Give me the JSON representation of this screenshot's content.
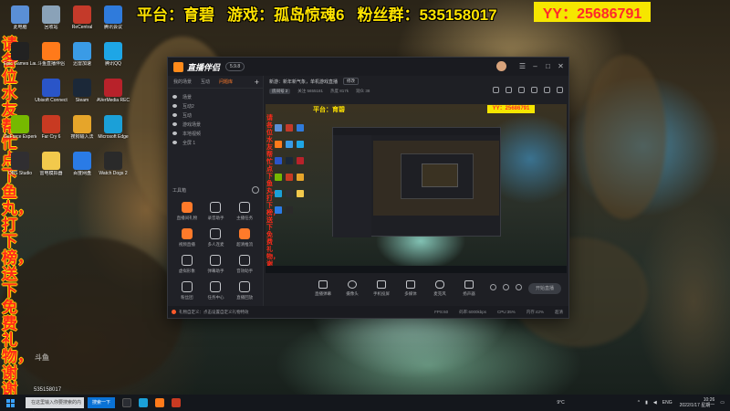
{
  "overlay": {
    "platform": "平台：育碧",
    "game": "游戏：孤岛惊魂6",
    "fans": "粉丝群：535158017",
    "qq": "YY：25686791",
    "side_text": "请各位水友帮忙点下鱼丸，打下榜，送下免费礼物，谢谢"
  },
  "desktop": {
    "icons": [
      {
        "label": "此电脑",
        "icon": "computer-icon",
        "color": "#5a8fd6"
      },
      {
        "label": "回收站",
        "icon": "recycle-bin-icon",
        "color": "#8aa2b8"
      },
      {
        "label": "ReCentral",
        "icon": "recentral-icon",
        "color": "#c43a2a"
      },
      {
        "label": "腾讯会议",
        "icon": "meeting-icon",
        "color": "#2f7bdc"
      },
      {
        "label": "Epic Games Launcher",
        "icon": "epic-icon",
        "color": "#222222"
      },
      {
        "label": "斗鱼直播伴侣",
        "icon": "douyu-icon",
        "color": "#ff7a1a"
      },
      {
        "label": "迅雷加速",
        "icon": "xunlei-icon",
        "color": "#3a9be6"
      },
      {
        "label": "腾讯QQ",
        "icon": "qq-icon",
        "color": "#1ea6e6"
      },
      {
        "label": "Ubisoft Connect",
        "icon": "ubisoft-icon",
        "color": "#2a55c8"
      },
      {
        "label": "Steam",
        "icon": "steam-icon",
        "color": "#1b2838"
      },
      {
        "label": "AVerMedia RECentral",
        "icon": "avermedia-icon",
        "color": "#b8222a"
      },
      {
        "label": "GeForce Experience",
        "icon": "nvidia-icon",
        "color": "#76b900"
      },
      {
        "label": "Far Cry 6",
        "icon": "farcry-icon",
        "color": "#c83a22"
      },
      {
        "label": "搜狗输入法",
        "icon": "sogou-icon",
        "color": "#e6a52a"
      },
      {
        "label": "Microsoft Edge",
        "icon": "edge-icon",
        "color": "#1ba0d8"
      },
      {
        "label": "OBS Studio",
        "icon": "obs-icon",
        "color": "#302e31"
      },
      {
        "label": "雷电模拟器",
        "icon": "emulator-icon",
        "color": "#f2c94c"
      },
      {
        "label": "百度网盘",
        "icon": "baidu-icon",
        "color": "#2a7be6"
      },
      {
        "label": "Watch Dogs 2",
        "icon": "watchdogs-icon",
        "color": "#2a2a2a"
      }
    ]
  },
  "app": {
    "name": "直播伴侣",
    "version": "5.9.8",
    "window_controls": [
      "menu-icon",
      "minimize-icon",
      "maximize-icon",
      "close-icon"
    ],
    "left_tabs": [
      "我的场景",
      "互动",
      "问题库"
    ],
    "scenes": [
      "场景",
      "互动2",
      "互动",
      "游戏场景",
      "本地视频",
      "全屏 1"
    ],
    "tools_title": "工具箱",
    "tools": [
      {
        "label": "直播间礼物",
        "highlight": true
      },
      {
        "label": "录音助手",
        "highlight": false
      },
      {
        "label": "主播任务",
        "highlight": false
      },
      {
        "label": "视频直播",
        "highlight": true
      },
      {
        "label": "多人连麦",
        "highlight": false
      },
      {
        "label": "超清推流",
        "highlight": true
      },
      {
        "label": "虚拟形象",
        "highlight": false
      },
      {
        "label": "弹幕助手",
        "highlight": false
      },
      {
        "label": "音效助手",
        "highlight": false
      },
      {
        "label": "粉丝团",
        "highlight": false
      },
      {
        "label": "任务中心",
        "highlight": false
      },
      {
        "label": "直播回放",
        "highlight": false
      }
    ],
    "topic": "新游：新年新气象，单机游戏直播",
    "topic_button": "修改",
    "stats": {
      "room_badge": "房间号 2",
      "followers": "关注 5655181",
      "hot": "热度 817k",
      "viewers": "观众 38"
    },
    "controls": [
      "直播弹幕",
      "摄像头",
      "手机投屏",
      "多媒体",
      "麦克风",
      "扬声器"
    ],
    "start_button": "开始直播",
    "status": {
      "message": "礼物自定义：点击设置自定义礼物特效",
      "fps": "FPS:60",
      "bitrate": "码率:6000kbps",
      "cpu": "CPU:35%",
      "memory": "内存:42%",
      "quality": "超清"
    }
  },
  "taskbar": {
    "search_placeholder": "在这里输入你要搜索的内容",
    "search_button": "搜索一下",
    "weather": "9°C",
    "lang": "ENG",
    "time": "10:26",
    "date": "2022/1/17 星期一"
  },
  "watermark": "斗鱼",
  "room_number": "535158017"
}
